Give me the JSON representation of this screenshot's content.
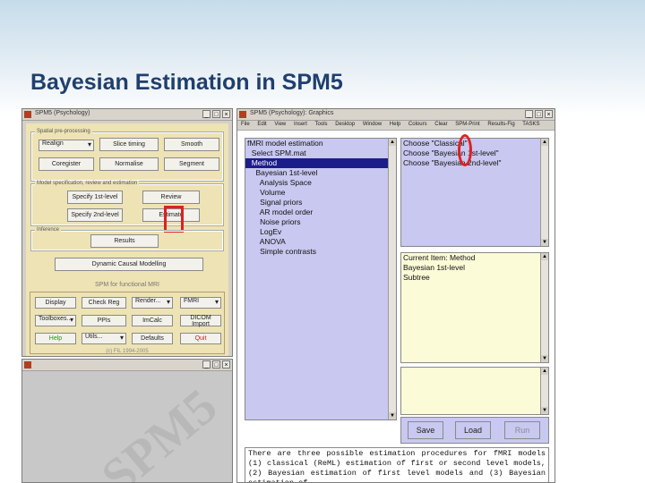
{
  "slide": {
    "title": "Bayesian Estimation in SPM5"
  },
  "main_window": {
    "title": "SPM5 (Psychology)",
    "controls": [
      "_",
      "□",
      "×"
    ],
    "frame1_label": "Spatial pre-processing",
    "row1": [
      "Realign",
      "Slice timing",
      "Smooth"
    ],
    "row2": [
      "Coregister",
      "Normalise",
      "Segment"
    ],
    "frame2_label": "Model specification, review and estimation",
    "specify_first": "Specify 1st-level",
    "specify_second": "Specify 2nd-level",
    "review": "Review",
    "estimate": "Estimate",
    "frame3_label": "Inference",
    "results": "Results",
    "dcm": "Dynamic Causal Modelling",
    "footer": "SPM for functional MRI",
    "util1": [
      "Display",
      "Check Reg",
      "Render...",
      "FMRI"
    ],
    "util2": [
      "Toolboxes...",
      "PPIs",
      "ImCalc",
      "DICOM Import"
    ],
    "help": "Help",
    "utils": "Utils...",
    "defaults": "Defaults",
    "quit": "Quit",
    "copyright": "(c) FIL 1994-2005"
  },
  "graphics_window": {
    "title": "SPM5 (Psychology): Graphics",
    "menu": [
      "File",
      "Edit",
      "View",
      "Insert",
      "Tools",
      "Desktop",
      "Window",
      "Help",
      "Colours",
      "Clear",
      "SPM-Print",
      "Results-Fig",
      "TASKS"
    ],
    "controls": [
      "_",
      "□",
      "×"
    ],
    "tree": [
      "fMRI model estimation",
      "  Select SPM.mat",
      "  Method",
      "    Bayesian 1st-level",
      "      Analysis Space",
      "      Volume",
      "      Signal priors",
      "      AR model order",
      "      Noise priors",
      "      LogEv",
      "      ANOVA",
      "      Simple contrasts"
    ],
    "choices": [
      "Choose \"Classical\"",
      "Choose \"Bayesian 1st-level\"",
      "Choose \"Bayesian 2nd-level\""
    ],
    "current": [
      "Current Item: Method",
      "Bayesian 1st-level",
      "Subtree"
    ],
    "save": "Save",
    "load": "Load",
    "run": "Run",
    "help_text": "There are three possible estimation procedures for fMRI models (1) classical (ReML) estimation of first or second level models, (2) Bayesian estimation of first level models and (3) Bayesian estimation of"
  },
  "lower_window": {
    "controls": [
      "_",
      "□",
      "×"
    ],
    "watermark": "SPM5"
  },
  "colors": {
    "title": "#1f3f6e",
    "highlight": "#e02020",
    "list_bg": "#c8c8f0",
    "panel_bg": "#ede3b4"
  }
}
